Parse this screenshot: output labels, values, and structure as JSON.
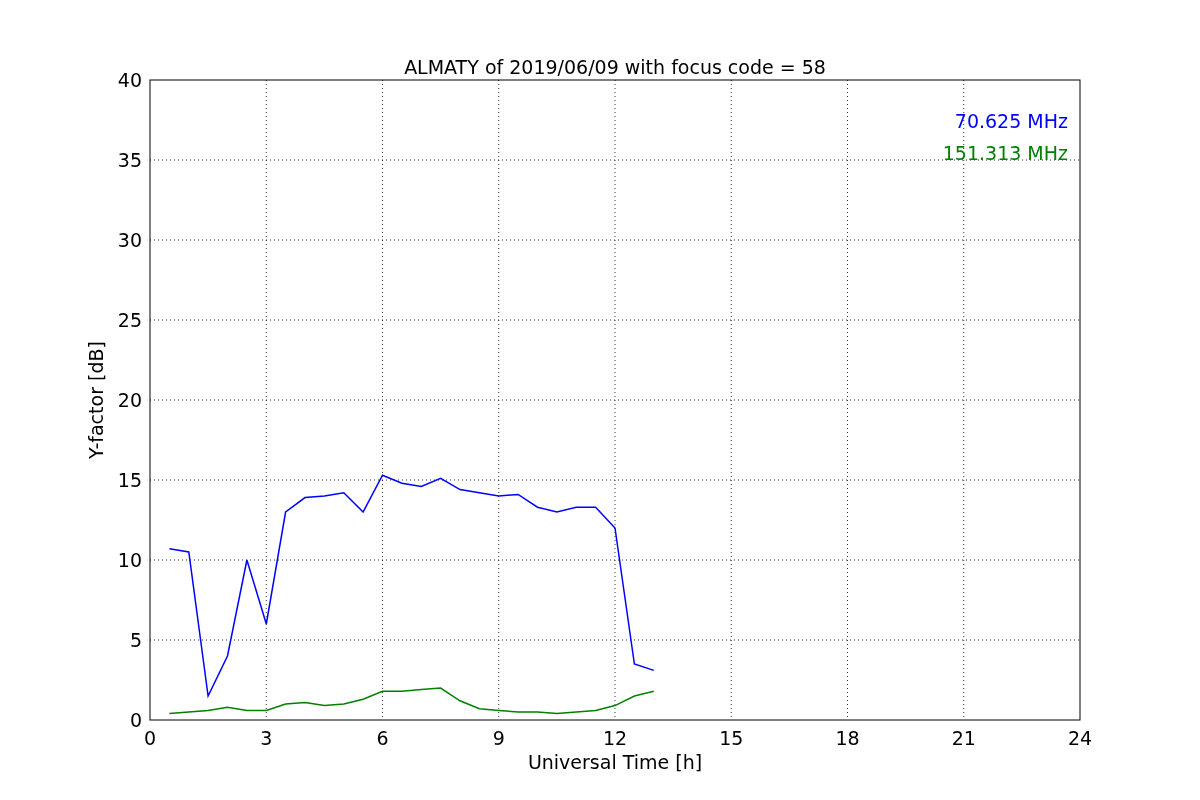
{
  "chart_data": {
    "type": "line",
    "title": "ALMATY of 2019/06/09 with focus code = 58",
    "xlabel": "Universal Time [h]",
    "ylabel": "Y-factor [dB]",
    "x": [
      0.5,
      1,
      1.5,
      2,
      2.5,
      3,
      3.5,
      4,
      4.5,
      5,
      5.5,
      6,
      6.5,
      7,
      7.5,
      8,
      8.5,
      9,
      9.5,
      10,
      10.5,
      11,
      11.5,
      12,
      12.5,
      13
    ],
    "series": [
      {
        "name": "70.625 MHz",
        "color": "#0000ff",
        "values": [
          10.7,
          10.5,
          1.5,
          4,
          10,
          6,
          13,
          13.9,
          14,
          14.2,
          13,
          15.3,
          14.8,
          14.6,
          15.1,
          14.4,
          14.2,
          14,
          14.1,
          13.3,
          13,
          13.3,
          13.3,
          12,
          3.5,
          3.1
        ]
      },
      {
        "name": "151.313 MHz",
        "color": "#008000",
        "values": [
          0.4,
          0.5,
          0.6,
          0.8,
          0.6,
          0.6,
          1,
          1.1,
          0.9,
          1,
          1.3,
          1.8,
          1.8,
          1.9,
          2,
          1.2,
          0.7,
          0.6,
          0.5,
          0.5,
          0.4,
          0.5,
          0.6,
          0.9,
          1.5,
          1.8
        ]
      }
    ],
    "xlim": [
      0,
      24
    ],
    "ylim": [
      0,
      40
    ],
    "xticks": [
      0,
      3,
      6,
      9,
      12,
      15,
      18,
      21,
      24
    ],
    "yticks": [
      0,
      5,
      10,
      15,
      20,
      25,
      30,
      35,
      40
    ],
    "grid": true
  }
}
